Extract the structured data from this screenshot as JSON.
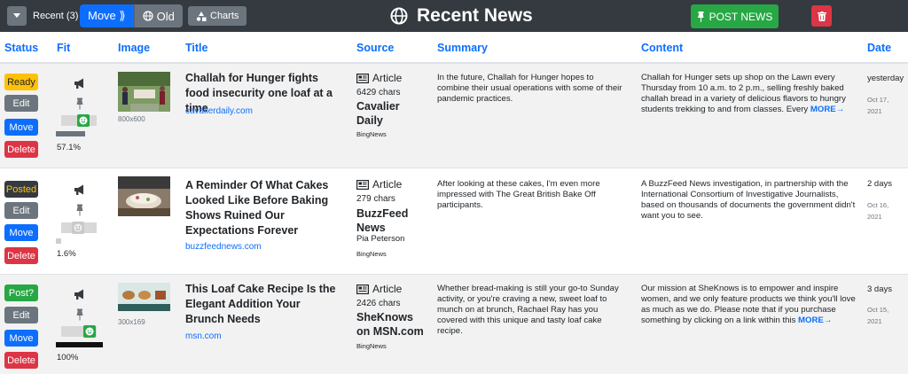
{
  "toolbar": {
    "recent_label": "Recent (3)",
    "move_label": "Move ⟫",
    "old_label": "Old",
    "charts_label": "Charts",
    "title": "Recent News",
    "post_news_label": "POST NEWS"
  },
  "columns": [
    "Status",
    "Fit",
    "Image",
    "Title",
    "Source",
    "Summary",
    "Content",
    "Date"
  ],
  "colors": {
    "primary": "#0d6efd",
    "success": "#28a745",
    "danger": "#dc3545",
    "warning": "#ffc107",
    "secondary": "#6c757d",
    "dark": "#343a40"
  },
  "actions": {
    "edit": "Edit",
    "move": "Move",
    "delete": "Delete"
  },
  "rows": [
    {
      "status": "Ready",
      "fit_pct": "57.1%",
      "fit_fraction": 0.571,
      "image_size": "800x600",
      "title": "Challah for Hunger fights food insecurity one loaf at a time",
      "domain": "cavalierdaily.com",
      "source_type": "Article",
      "source_chars": "6429 chars",
      "source_name": "Cavalier Daily",
      "source_author": "",
      "source_feed": "BingNews",
      "summary": "In the future, Challah for Hunger hopes to combine their usual operations with some of their pandemic practices.",
      "content": "Challah for Hunger sets up shop on the Lawn every Thursday from 10 a.m. to 2 p.m., selling freshly baked challah bread in a variety of delicious flavors to hungry students trekking to and from classes. Every",
      "more": "MORE→",
      "date_rel": "yesterday",
      "date_abs": "Oct 17, 2021"
    },
    {
      "status": "Posted",
      "fit_pct": "1.6%",
      "fit_fraction": 0.016,
      "image_size": "",
      "title": "A Reminder Of What Cakes Looked Like Before Baking Shows Ruined Our Expectations Forever",
      "domain": "buzzfeednews.com",
      "source_type": "Article",
      "source_chars": "279 chars",
      "source_name": "BuzzFeed News",
      "source_author": "Pia Peterson",
      "source_feed": "BingNews",
      "summary": "After looking at these cakes, I'm even more impressed with The Great British Bake Off participants.",
      "content": "A BuzzFeed News investigation, in partnership with the International Consortium of Investigative Journalists, based on thousands of documents the government didn't want you to see.",
      "more": "",
      "date_rel": "2 days",
      "date_abs": "Oct 16, 2021"
    },
    {
      "status": "Post?",
      "fit_pct": "100%",
      "fit_fraction": 1.0,
      "image_size": "300x169",
      "title": "This Loaf Cake Recipe Is the Elegant Addition Your Brunch Needs",
      "domain": "msn.com",
      "source_type": "Article",
      "source_chars": "2426 chars",
      "source_name": "SheKnows on MSN.com",
      "source_author": "",
      "source_feed": "BingNews",
      "summary": "Whether bread-making is still your go-to Sunday activity, or you're craving a new, sweet loaf to munch on at brunch, Rachael Ray has you covered with this unique and tasty loaf cake recipe.",
      "content": "Our mission at SheKnows is to empower and inspire women, and we only feature products we think you'll love as much as we do. Please note that if you purchase something by clicking on a link within this",
      "more": "MORE→",
      "date_rel": "3 days",
      "date_abs": "Oct 15, 2021"
    }
  ]
}
